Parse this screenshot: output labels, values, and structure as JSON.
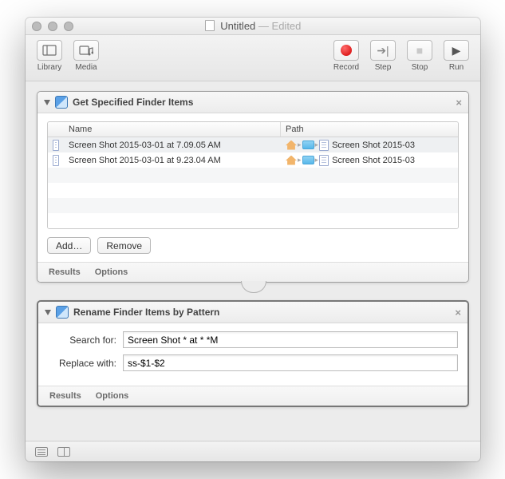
{
  "window": {
    "title": "Untitled",
    "edited": "Edited"
  },
  "toolbar": {
    "library": "Library",
    "media": "Media",
    "record": "Record",
    "step": "Step",
    "stop": "Stop",
    "run": "Run"
  },
  "action1": {
    "title": "Get Specified Finder Items",
    "columns": {
      "name": "Name",
      "path": "Path"
    },
    "rows": [
      {
        "name": "Screen Shot 2015-03-01 at 7.09.05 AM",
        "pathfile": "Screen Shot 2015-03"
      },
      {
        "name": "Screen Shot 2015-03-01 at 9.23.04 AM",
        "pathfile": "Screen Shot 2015-03"
      }
    ],
    "add": "Add…",
    "remove": "Remove",
    "results": "Results",
    "options": "Options"
  },
  "action2": {
    "title": "Rename Finder Items by Pattern",
    "search_label": "Search for:",
    "search_value": "Screen Shot * at * *M",
    "replace_label": "Replace with:",
    "replace_value": "ss-$1-$2",
    "results": "Results",
    "options": "Options"
  }
}
